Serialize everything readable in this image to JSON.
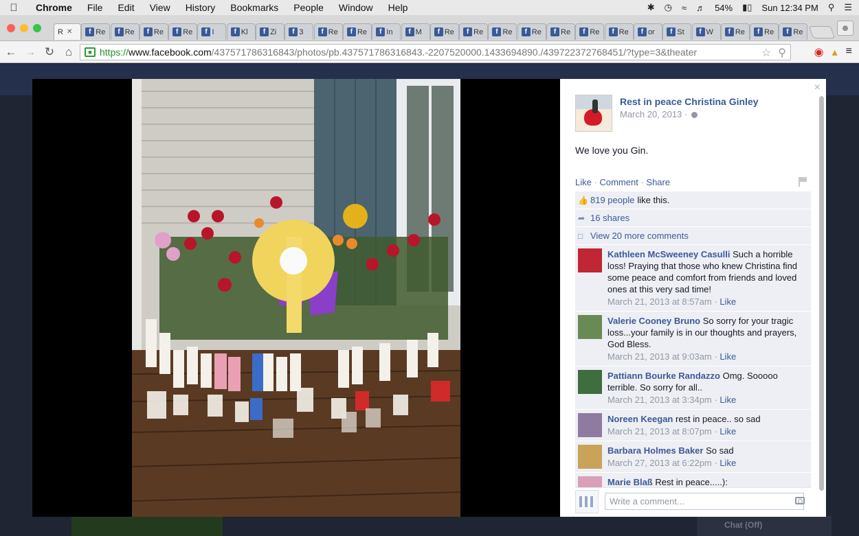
{
  "menubar": {
    "apple": "",
    "app_name": "Chrome",
    "menus": [
      "File",
      "Edit",
      "View",
      "History",
      "Bookmarks",
      "People",
      "Window",
      "Help"
    ],
    "battery": "54%",
    "clock": "Sun 12:34 PM"
  },
  "tabs": {
    "active_label": "R",
    "labels": [
      "Re",
      "Re",
      "Re",
      "Re",
      "I",
      "Kl",
      "Zi",
      "3",
      "Re",
      "Re",
      "In",
      "M",
      "Re",
      "Re",
      "Re",
      "Re",
      "Re",
      "Re",
      "Re",
      "or",
      "St",
      "W",
      "Re",
      "Re",
      "Re"
    ]
  },
  "toolbar": {
    "url_scheme": "https://",
    "url_host": "www.facebook.com",
    "url_path": "/437571786316843/photos/pb.437571786316843.-2207520000.1433694890./439722372768451/?type=3&theater"
  },
  "post": {
    "page_name": "Rest in peace Christina Ginley",
    "date": "March 20, 2013 ·",
    "text": "We love you Gin.",
    "actions": [
      "Like",
      "Comment",
      "Share"
    ],
    "likes_count": "819 people",
    "likes_suffix": "like this.",
    "shares": "16 shares",
    "view_more": "View 20 more comments",
    "write_placeholder": "Write a comment..."
  },
  "comments": [
    {
      "name": "Kathleen McSweeney Casulli",
      "text": "Such a horrible loss! Praying that those who knew Christina find some peace and comfort from friends and loved ones at this very sad time!",
      "time": "March 21, 2013 at 8:57am",
      "like": "Like"
    },
    {
      "name": "Valerie Cooney Bruno",
      "text": "So sorry for your tragic loss...your family is in our thoughts and prayers, God Bless.",
      "time": "March 21, 2013 at 9:03am",
      "like": "Like"
    },
    {
      "name": "Pattiann Bourke Randazzo",
      "text": "Omg. Sooooo terrible. So sorry for all..",
      "time": "March 21, 2013 at 3:34pm",
      "like": "Like"
    },
    {
      "name": "Noreen Keegan",
      "text": "rest in peace.. so sad",
      "time": "March 21, 2013 at 8:07pm",
      "like": "Like"
    },
    {
      "name": "Barbara Holmes Baker",
      "text": "So sad",
      "time": "March 27, 2013 at 6:22pm",
      "like": "Like"
    },
    {
      "name": "Marie Blaß",
      "text": "Rest in peace.....):",
      "time": "",
      "like": ""
    }
  ],
  "page_bg": {
    "chat": "Chat (Off)"
  },
  "colors": {
    "fb_blue": "#3b5998",
    "ufi_bg": "#edeff4",
    "meta_gray": "#9197a3"
  }
}
